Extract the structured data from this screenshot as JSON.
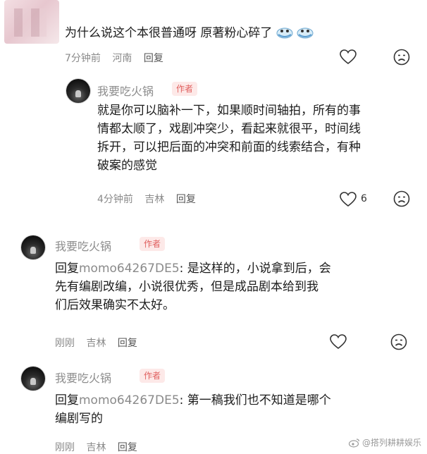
{
  "comment1": {
    "text": "为什么说这个本很普通呀 原著粉心碎了",
    "emoji_icons": [
      "crying-face-icon",
      "crying-face-icon"
    ],
    "time": "7分钟前",
    "location": "河南",
    "reply_label": "回复"
  },
  "reply1": {
    "username": "我要吃火锅",
    "badge": "作者",
    "lines": [
      "就是你可以脑补一下，如果顺时间轴拍，所有的事",
      "情都太顺了，戏剧冲突少，看起来就很平，时间线",
      "拆开，可以把后面的冲突和前面的线索结合，有种",
      "破案的感觉"
    ],
    "time": "4分钟前",
    "location": "吉林",
    "reply_label": "回复",
    "like_count": "6"
  },
  "comment2": {
    "username": "我要吃火锅",
    "badge": "作者",
    "reply_prefix": "回复",
    "mention": "momo64267DE5",
    "line1_rest": ": 是这样的，小说拿到后，会",
    "line2": "先有编剧改编，小说很优秀，但是成品剧本给到我",
    "line3": "们后效果确实不太好。",
    "time": "刚刚",
    "location": "吉林",
    "reply_label": "回复"
  },
  "comment3": {
    "username": "我要吃火锅",
    "badge": "作者",
    "reply_prefix": "回复",
    "mention": "momo64267DE5",
    "line1_rest": ": 第一稿我们也不知道是哪个",
    "line2": "编剧写的",
    "time": "刚刚",
    "location": "吉林",
    "reply_label": "回复"
  },
  "watermark": {
    "text": "@搭列耕耕娱乐",
    "icon": "weibo-icon"
  }
}
